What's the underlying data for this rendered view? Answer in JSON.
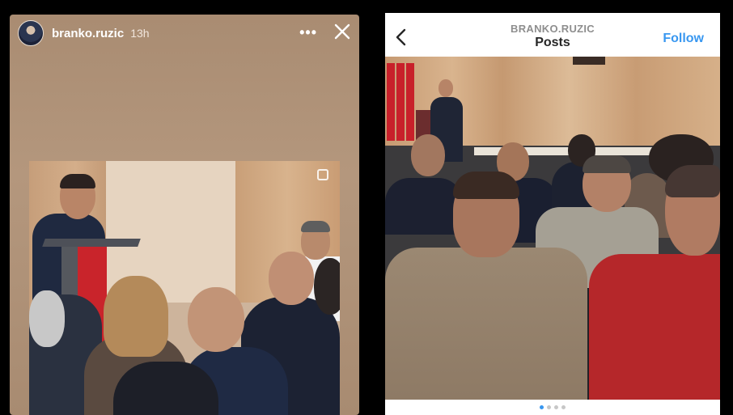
{
  "story": {
    "username": "branko.ruzic",
    "time": "13h",
    "more_label": "•••",
    "close_icon": "close-icon",
    "more_icon": "more-horizontal-icon"
  },
  "post": {
    "username": "BRANKO.RUZIC",
    "title": "Posts",
    "follow_label": "Follow",
    "back_icon": "chevron-left-icon",
    "carousel": {
      "count": 4,
      "active": 0
    },
    "colors": {
      "follow": "#3897f0",
      "username": "#8e8e8e",
      "title": "#262626"
    }
  }
}
